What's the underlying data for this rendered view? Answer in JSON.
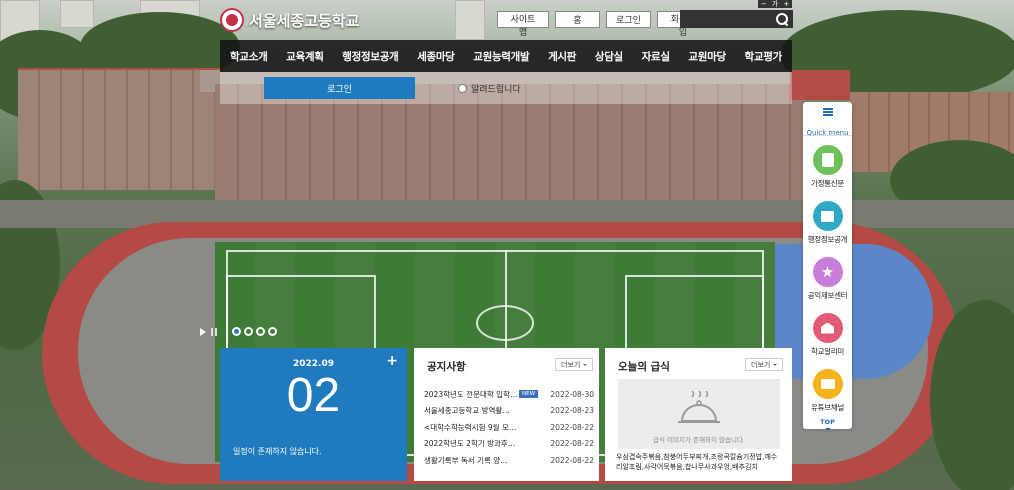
{
  "site": {
    "name": "서울세종고등학교"
  },
  "util": {
    "links": [
      "사이트맵",
      "홈",
      "로그인",
      "회원가입"
    ],
    "zoom_minus": "−",
    "zoom_label": "가",
    "zoom_plus": "+"
  },
  "search": {
    "placeholder": ""
  },
  "nav": {
    "items": [
      "학교소개",
      "교육계획",
      "행정정보공개",
      "세종마당",
      "교원능력개발",
      "게시판",
      "상담실",
      "자료실",
      "교원마당",
      "학교평가"
    ]
  },
  "subpanel": {
    "login_label": "로그인",
    "notice_label": "알려드립니다"
  },
  "quick": {
    "title": "Quick menu",
    "items": [
      {
        "label": "가정통신문",
        "icon": "newsletter-icon",
        "color": "#6fbf5a"
      },
      {
        "label": "행정정보공개",
        "icon": "document-search-icon",
        "color": "#31a7c6"
      },
      {
        "label": "공익제보센터",
        "icon": "star-icon",
        "color": "#c77ed6"
      },
      {
        "label": "학교알리미",
        "icon": "school-icon",
        "color": "#e25a76"
      },
      {
        "label": "유튜브채널",
        "icon": "video-icon",
        "color": "#f4b21b"
      }
    ],
    "top_label": "TOP"
  },
  "slider": {
    "total": 4,
    "active": 1
  },
  "calendar": {
    "year_month": "2022.09",
    "day": "02",
    "plus": "+",
    "message": "일정이 존재하지 않습니다."
  },
  "notice": {
    "title": "공지사항",
    "more_label": "더보기",
    "items": [
      {
        "title": "2023학년도 전문대학 입학…",
        "date": "2022-08-30",
        "badge": "NEW"
      },
      {
        "title": "서울세종고등학교 방역활…",
        "date": "2022-08-23"
      },
      {
        "title": "<대학수학능력시험 9월 모…",
        "date": "2022-08-22"
      },
      {
        "title": "2022학년도 2학기 방과후…",
        "date": "2022-08-22"
      },
      {
        "title": "생활기록부 독서 기록 양…",
        "date": "2022-08-22"
      }
    ]
  },
  "meal": {
    "title": "오늘의 급식",
    "more_label": "더보기",
    "empty_text": "급식 이미지가 존재하지 않습니다.",
    "menu": "우삼겹숙주볶음,참붕어두부찌개,조랑곡칼슘기정밥,깨수리알조림,사각어묵볶음,찹나무사과우엉,배추김치"
  },
  "colors": {
    "accent": "#1f7bbd",
    "nav_bg": "#141414",
    "logo_red": "#c2324b"
  }
}
